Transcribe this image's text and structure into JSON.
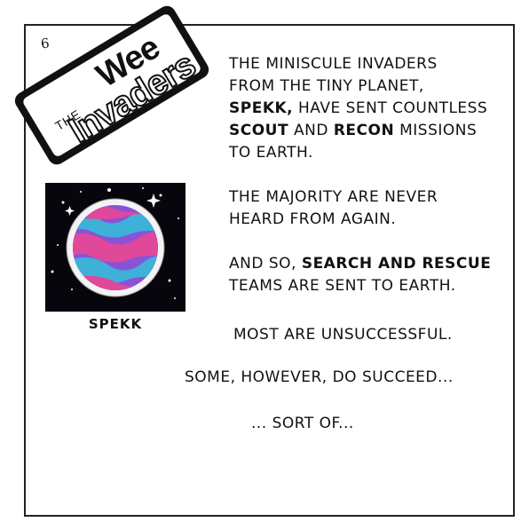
{
  "page_number": "6",
  "title": {
    "the": "THE",
    "wee": "Wee",
    "invaders": "Invaders"
  },
  "paragraphs": {
    "p1_l1": "THE MINISCULE INVADERS",
    "p1_l2": "FROM THE TINY PLANET,",
    "p1_l3a": "SPEKK,",
    "p1_l3b": " HAVE SENT COUNTLESS",
    "p1_l4a": "SCOUT",
    "p1_l4b": " AND ",
    "p1_l4c": "RECON",
    "p1_l4d": " MISSIONS",
    "p1_l5": "TO EARTH.",
    "p2_l1": "THE MAJORITY ARE NEVER",
    "p2_l2": "HEARD FROM AGAIN.",
    "p3_l1a": "AND SO, ",
    "p3_l1b": "SEARCH AND RESCUE",
    "p3_l2": "TEAMS ARE SENT TO EARTH.",
    "p4": "MOST ARE UNSUCCESSFUL.",
    "p5": "SOME, HOWEVER, DO SUCCEED...",
    "p6": "... SORT OF..."
  },
  "planet_caption": "SPEKK",
  "colors": {
    "space": "#06060c",
    "planet_pink": "#e0489a",
    "planet_cyan": "#3fb0d8",
    "planet_purple": "#8a52d6",
    "planet_blue": "#3a3aa8"
  }
}
